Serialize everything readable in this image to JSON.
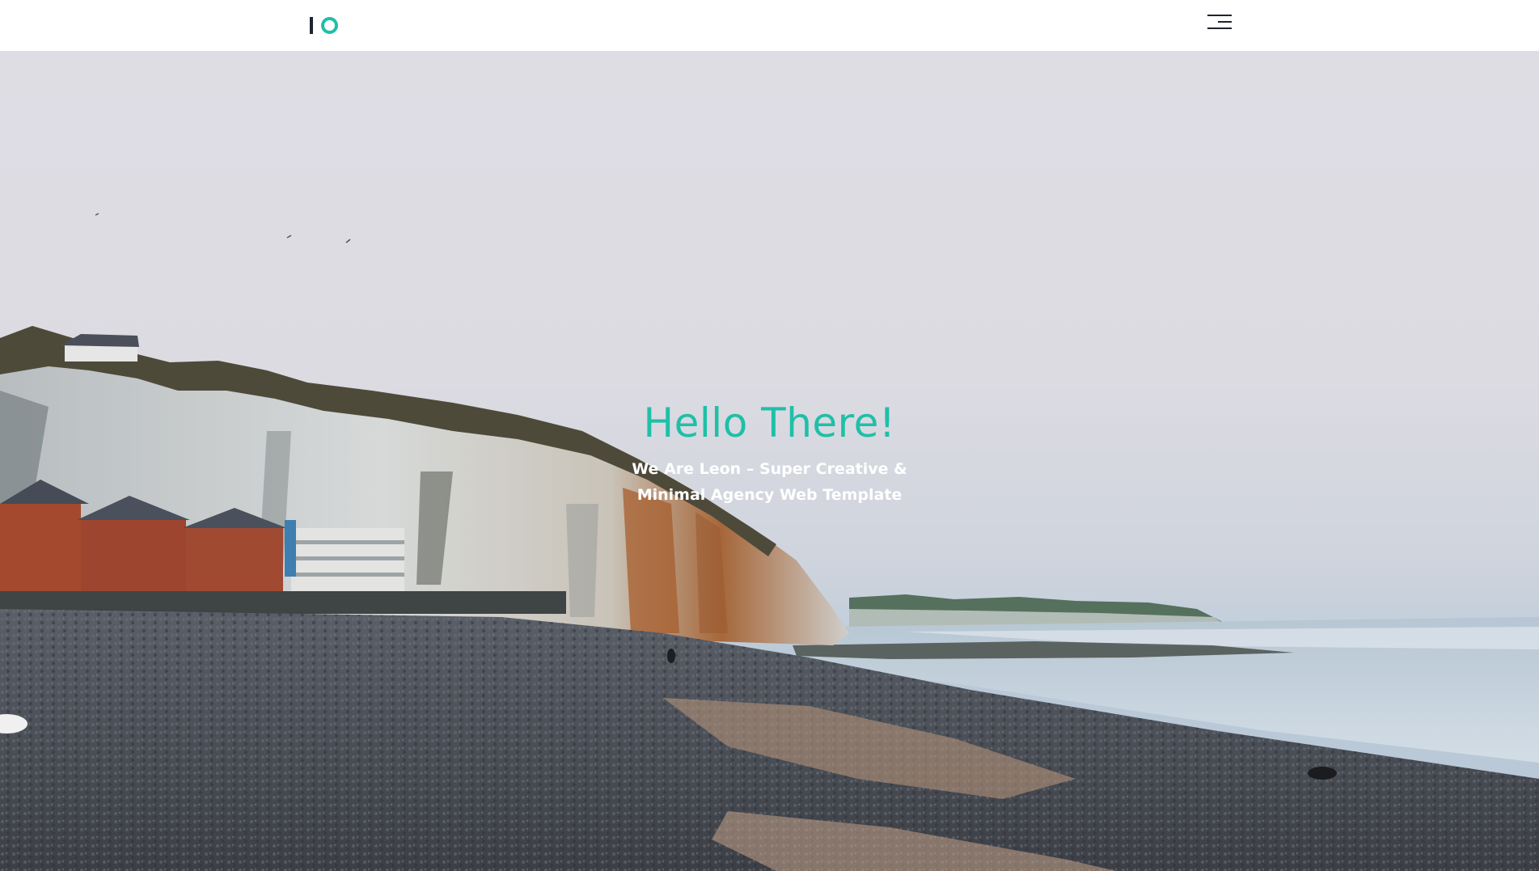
{
  "header": {
    "logo_icon": "io-logo-icon",
    "menu_icon": "hamburger-menu-icon"
  },
  "hero": {
    "title": "Hello There!",
    "subtitle": "We Are Leon – Super Creative & Minimal Agency Web Template",
    "background": "coastal-chalk-cliffs-pebble-beach-photo"
  },
  "colors": {
    "accent": "#1fbfa8",
    "dark": "#1d2530",
    "header_bg": "#ffffff",
    "subtitle": "#ffffff"
  }
}
